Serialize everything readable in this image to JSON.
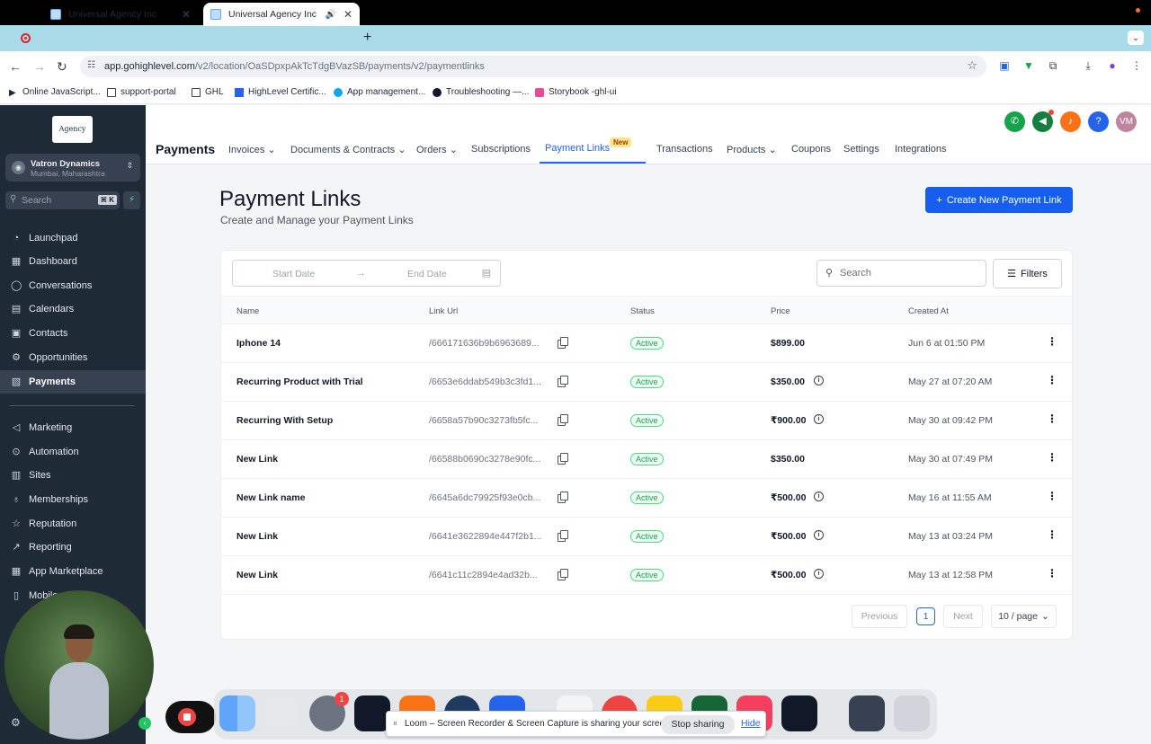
{
  "browser": {
    "tabs": [
      {
        "title": "Universal Agency Inc"
      },
      {
        "title": "Universal Agency Inc"
      }
    ],
    "url_host": "app.gohighlevel.com",
    "url_path": "/v2/location/OaSDpxpAkTcTdgBVazSB/payments/v2/paymentlinks",
    "bookmarks": [
      {
        "label": "Online JavaScript..."
      },
      {
        "label": "support-portal"
      },
      {
        "label": "GHL"
      },
      {
        "label": "HighLevel Certific..."
      },
      {
        "label": "App management..."
      },
      {
        "label": "Troubleshooting —..."
      },
      {
        "label": "Storybook -ghl-ui"
      }
    ]
  },
  "sidebar": {
    "logo": "Agency",
    "account_name": "Vatron Dynamics",
    "account_location": "Mumbai, Maharashtra",
    "search_placeholder": "Search",
    "search_shortcut": "⌘ K",
    "items": [
      {
        "label": "Launchpad",
        "icon": "rocket-icon"
      },
      {
        "label": "Dashboard",
        "icon": "grid-icon"
      },
      {
        "label": "Conversations",
        "icon": "chat-icon"
      },
      {
        "label": "Calendars",
        "icon": "calendar-icon"
      },
      {
        "label": "Contacts",
        "icon": "contacts-icon"
      },
      {
        "label": "Opportunities",
        "icon": "funnel-icon"
      },
      {
        "label": "Payments",
        "icon": "payments-icon",
        "active": true
      },
      {
        "label": "Marketing",
        "icon": "send-icon"
      },
      {
        "label": "Automation",
        "icon": "automation-icon"
      },
      {
        "label": "Sites",
        "icon": "sites-icon"
      },
      {
        "label": "Memberships",
        "icon": "membership-icon"
      },
      {
        "label": "Reputation",
        "icon": "star-icon"
      },
      {
        "label": "Reporting",
        "icon": "chart-icon"
      },
      {
        "label": "App Marketplace",
        "icon": "apps-icon"
      },
      {
        "label": "Mobile",
        "icon": "mobile-icon"
      }
    ]
  },
  "header": {
    "title": "Payments",
    "avatar_initials": "VM",
    "colors": {
      "phone": "#16a34a",
      "megaphone": "#15803d",
      "bell": "#f97316",
      "help": "#2563eb",
      "avatar": "#c084a0"
    },
    "menu": [
      {
        "label": "Invoices",
        "dropdown": true
      },
      {
        "label": "Documents & Contracts",
        "dropdown": true
      },
      {
        "label": "Orders",
        "dropdown": true
      },
      {
        "label": "Subscriptions"
      },
      {
        "label": "Payment Links",
        "active": true,
        "badge": "New"
      },
      {
        "label": "Transactions"
      },
      {
        "label": "Products",
        "dropdown": true
      },
      {
        "label": "Coupons"
      },
      {
        "label": "Settings"
      },
      {
        "label": "Integrations"
      }
    ]
  },
  "page": {
    "title": "Payment Links",
    "subtitle": "Create and Manage your Payment Links",
    "create_button": "Create New Payment Link",
    "start_date_placeholder": "Start Date",
    "end_date_placeholder": "End Date",
    "search_placeholder": "Search",
    "filters_label": "Filters"
  },
  "table": {
    "columns": [
      "Name",
      "Link Url",
      "Status",
      "Price",
      "Created At"
    ],
    "rows": [
      {
        "name": "Iphone 14",
        "link": "/666171636b9b6963689...",
        "status": "Active",
        "price": "$899.00",
        "info": false,
        "created": "Jun 6 at 01:50 PM"
      },
      {
        "name": "Recurring Product with Trial",
        "link": "/6653e6ddab549b3c3fd1...",
        "status": "Active",
        "price": "$350.00",
        "info": true,
        "created": "May 27 at 07:20 AM"
      },
      {
        "name": "Recurring With Setup",
        "link": "/6658a57b90c3273fb5fc...",
        "status": "Active",
        "price": "₹900.00",
        "info": true,
        "created": "May 30 at 09:42 PM"
      },
      {
        "name": "New Link",
        "link": "/66588b0690c3278e90fc...",
        "status": "Active",
        "price": "$350.00",
        "info": false,
        "created": "May 30 at 07:49 PM"
      },
      {
        "name": "New Link name",
        "link": "/6645a6dc79925f93e0cb...",
        "status": "Active",
        "price": "₹500.00",
        "info": true,
        "created": "May 16 at 11:55 AM"
      },
      {
        "name": "New Link",
        "link": "/6641e3622894e447f2b1...",
        "status": "Active",
        "price": "₹500.00",
        "info": true,
        "created": "May 13 at 03:24 PM"
      },
      {
        "name": "New Link",
        "link": "/6641c11c2894e4ad32b...",
        "status": "Active",
        "price": "₹500.00",
        "info": true,
        "created": "May 13 at 12:58 PM"
      }
    ]
  },
  "pagination": {
    "previous": "Previous",
    "current": "1",
    "next": "Next",
    "per_page": "10 / page"
  },
  "dock": {
    "settings_badge": "1"
  },
  "screen_share": {
    "message": "Loom – Screen Recorder & Screen Capture is sharing your screen.",
    "stop_label": "Stop sharing",
    "hide_label": "Hide"
  }
}
